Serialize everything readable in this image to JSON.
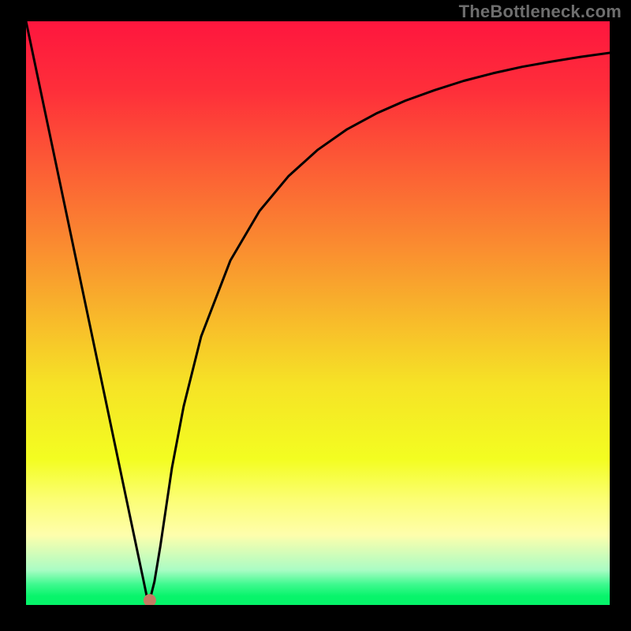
{
  "watermark": "TheBottleneck.com",
  "chart_data": {
    "type": "line",
    "title": "",
    "xlabel": "",
    "ylabel": "",
    "xlim": [
      0,
      100
    ],
    "ylim": [
      0,
      100
    ],
    "background_gradient": {
      "stops": [
        {
          "offset": 0.0,
          "color": "#fe163e"
        },
        {
          "offset": 0.12,
          "color": "#fe2f3a"
        },
        {
          "offset": 0.25,
          "color": "#fc5d35"
        },
        {
          "offset": 0.38,
          "color": "#fa8a30"
        },
        {
          "offset": 0.5,
          "color": "#f8b62b"
        },
        {
          "offset": 0.62,
          "color": "#f6e226"
        },
        {
          "offset": 0.75,
          "color": "#f3fd21"
        },
        {
          "offset": 0.82,
          "color": "#fcfe75"
        },
        {
          "offset": 0.88,
          "color": "#fefeac"
        },
        {
          "offset": 0.94,
          "color": "#aafcc4"
        },
        {
          "offset": 0.965,
          "color": "#3df98e"
        },
        {
          "offset": 0.985,
          "color": "#08f46b"
        },
        {
          "offset": 1.0,
          "color": "#05f369"
        }
      ]
    },
    "curve": {
      "x": [
        0,
        5,
        10,
        15,
        18,
        20,
        21,
        22,
        23,
        25,
        27,
        30,
        35,
        40,
        45,
        50,
        55,
        60,
        65,
        70,
        75,
        80,
        85,
        90,
        95,
        100
      ],
      "y": [
        100,
        76.2,
        52.4,
        28.6,
        14.3,
        4.8,
        0.0,
        4.0,
        10.0,
        23.5,
        34.0,
        46.0,
        59.0,
        67.5,
        73.5,
        78.0,
        81.5,
        84.2,
        86.4,
        88.2,
        89.8,
        91.1,
        92.2,
        93.1,
        93.9,
        94.6
      ]
    },
    "marker": {
      "x": 21.2,
      "y": 0.8,
      "color": "#c47b63",
      "radius_px": 8
    }
  }
}
